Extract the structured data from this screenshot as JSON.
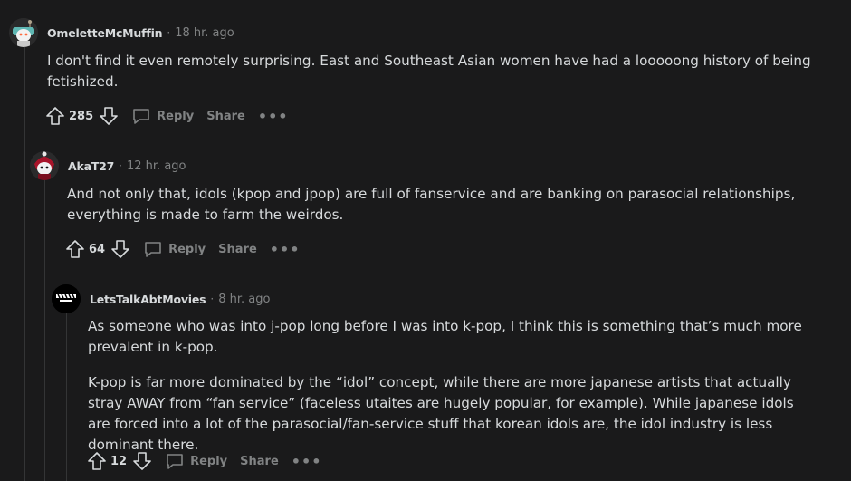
{
  "comments": [
    {
      "username": "OmeletteMcMuffin",
      "separator": "·",
      "time": "18 hr. ago",
      "paragraphs": [
        "I don't find it even remotely surprising. East and Southeast Asian women have had a looooong history of being fetishized."
      ],
      "votes": "285",
      "reply_label": "Reply",
      "share_label": "Share",
      "more_label": "•••",
      "avatar_icon": "snoo-avatar-teal-icon"
    },
    {
      "username": "AkaT27",
      "separator": "·",
      "time": "12 hr. ago",
      "paragraphs": [
        "And not only that, idols (kpop and jpop) are full of fanservice and are banking on parasocial relationships, everything is made to farm the weirdos."
      ],
      "votes": "64",
      "reply_label": "Reply",
      "share_label": "Share",
      "more_label": "•••",
      "avatar_icon": "snoo-avatar-red-icon"
    },
    {
      "username": "LetsTalkAbtMovies",
      "separator": "·",
      "time": "8 hr. ago",
      "paragraphs": [
        "As someone who was into j-pop long before I was into k-pop, I think this is something that’s much more prevalent in k-pop.",
        "K-pop is far more dominated by the “idol” concept, while there are more japanese artists that actually stray AWAY from “fan service” (faceless utaites are hugely popular, for example). While japanese idols are forced into a lot of the parasocial/fan-service stuff that korean idols are, the idol industry is less dominant there."
      ],
      "votes": "12",
      "reply_label": "Reply",
      "share_label": "Share",
      "more_label": "•••",
      "avatar_icon": "clapperboard-avatar-icon"
    }
  ],
  "colors": {
    "background": "#1a1a1b",
    "text": "#d7dadc",
    "meta": "#818384",
    "thread_line": "#343536"
  }
}
